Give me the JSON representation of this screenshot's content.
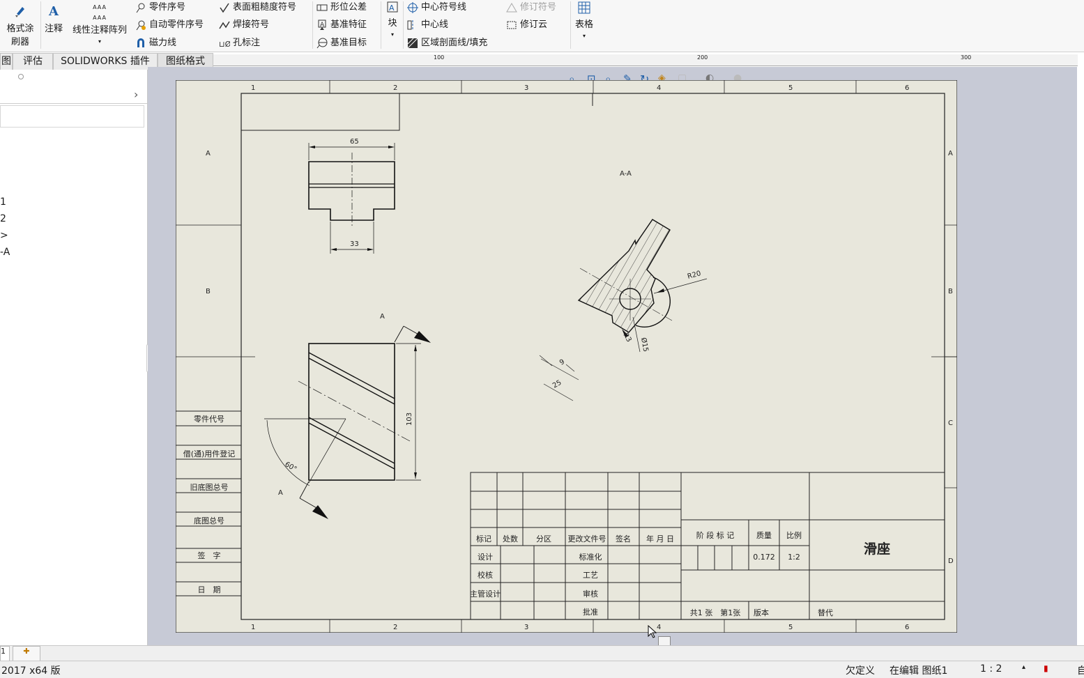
{
  "ribbon": {
    "format_painter": "格式涂\n刷器",
    "format_painter_l1": "格式涂",
    "format_painter_l2": "刷器",
    "note": "注释",
    "linear_note_pattern": "线性注释阵列",
    "balloon": "零件序号",
    "auto_balloon": "自动零件序号",
    "magnetic_line": "磁力线",
    "surface_finish": "表面粗糙度符号",
    "weld_symbol": "焊接符号",
    "hole_callout": "孔标注",
    "geometric_tolerance": "形位公差",
    "datum_feature": "基准特征",
    "datum_target": "基准目标",
    "block": "块",
    "center_mark": "中心符号线",
    "centerline": "中心线",
    "area_hatch": "区域剖面线/填充",
    "revision_symbol": "修订符号",
    "revision_cloud": "修订云",
    "table": "表格"
  },
  "tabs": [
    {
      "label": "图"
    },
    {
      "label": "评估"
    },
    {
      "label": "SOLIDWORKS 插件"
    },
    {
      "label": "图纸格式"
    }
  ],
  "ruler": {
    "marks": [
      "100",
      "200",
      "300"
    ]
  },
  "left_panel": {
    "items": [
      "1",
      "2",
      ">",
      "-A"
    ]
  },
  "drawing": {
    "zone_cols": [
      "1",
      "2",
      "3",
      "4",
      "5",
      "6"
    ],
    "zone_rows": [
      "A",
      "B",
      "C",
      "D"
    ],
    "section_label": "A-A",
    "cut_label": "A",
    "dims": {
      "width_top": "65",
      "width_bottom": "33",
      "height": "103",
      "angle": "60°",
      "radius": "R20",
      "hole": "Ø15",
      "r3": "R3",
      "d9": "9",
      "d25": "25"
    },
    "side_table": [
      "零件代号",
      "借(通)用件登记",
      "旧底图总号",
      "底图总号",
      "签　字",
      "日　期"
    ],
    "title_block": {
      "headers": [
        "标记",
        "处数",
        "分区",
        "更改文件号",
        "签名",
        "年 月 日"
      ],
      "rows": [
        "设计",
        "校核",
        "主管设计"
      ],
      "rows_right": [
        "标准化",
        "工艺",
        "审核",
        "批准"
      ],
      "stage_mark": "阶 段 标 记",
      "mass": "质量",
      "scale": "比例",
      "mass_value": "0.172",
      "scale_value": "1:2",
      "part_name": "滑座",
      "sheets": "共1 张　第1张",
      "version": "版本",
      "replaces": "替代"
    }
  },
  "status": {
    "version": "2017 x64 版",
    "underdefined": "欠定义",
    "editing": "在编辑 图纸1",
    "scale": "1 : 2",
    "more": "自"
  },
  "colors": {
    "sheet_bg": "#e8e7dc",
    "canvas_bg": "#c7cad6",
    "accent": "#1f5fa8"
  }
}
